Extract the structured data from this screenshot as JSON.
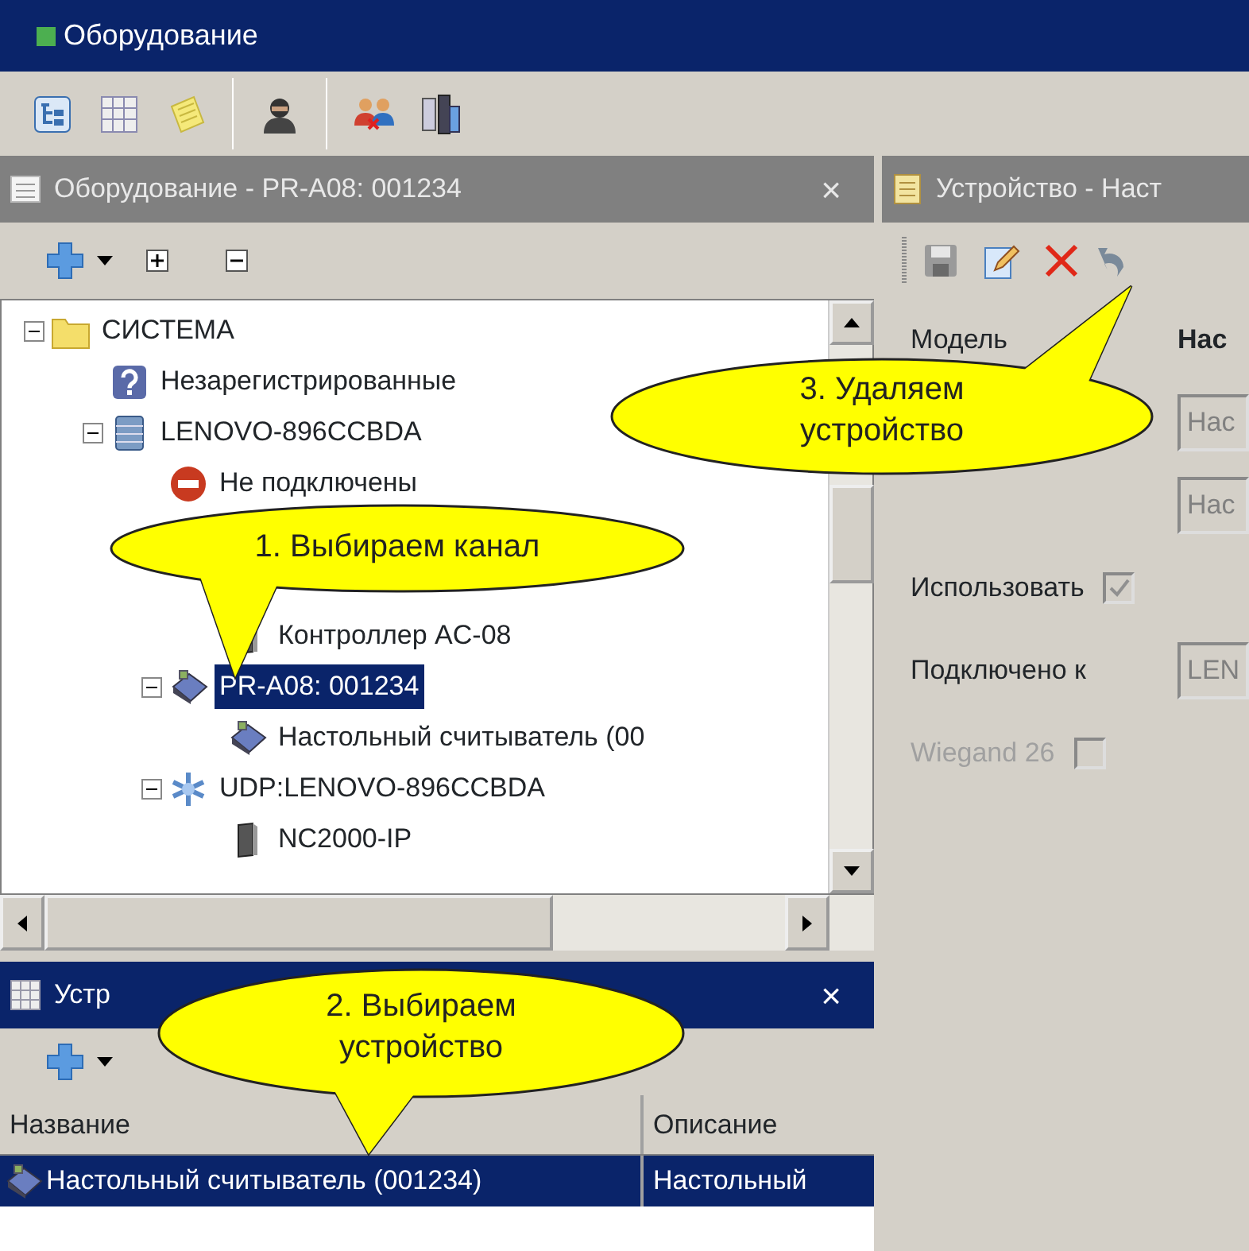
{
  "window": {
    "title": "Оборудование"
  },
  "tree_panel": {
    "title": "Оборудование - PR-A08: 001234",
    "close": "×",
    "tree": [
      {
        "label": "СИСТЕМА",
        "kind": "folder",
        "expanded": true,
        "selected": false,
        "children": [
          {
            "label": "Незарегистрированные",
            "kind": "question",
            "selected": false
          },
          {
            "label": "LENOVO-896CCBDA",
            "kind": "server",
            "expanded": true,
            "selected": false,
            "children": [
              {
                "label": "Не подключены",
                "kind": "stop",
                "selected": false
              },
              {
                "children": [
                  {
                    "label": "Контроллер AC-08",
                    "kind": "controller",
                    "selected": false
                  }
                ]
              },
              {
                "label": "PR-A08: 001234",
                "kind": "reader",
                "expanded": true,
                "selected": true,
                "children": [
                  {
                    "label": "Настольный считыватель (00",
                    "kind": "reader",
                    "selected": false
                  }
                ]
              },
              {
                "label": "UDP:LENOVO-896CCBDA",
                "kind": "network",
                "expanded": true,
                "selected": false,
                "children": [
                  {
                    "label": "NC2000-IP",
                    "kind": "controller",
                    "selected": false
                  }
                ]
              }
            ]
          }
        ]
      }
    ]
  },
  "devices_panel": {
    "title": "Устр",
    "close": "×",
    "columns": [
      "Название",
      "Описание"
    ],
    "rows": [
      {
        "cells": [
          "Настольный считыватель (001234)",
          "Настольный"
        ],
        "selected": true
      }
    ]
  },
  "device_panel": {
    "title": "Устройство - Наст",
    "rows": [
      {
        "kind": "value",
        "label": "Модель",
        "value": "Нас"
      },
      {
        "kind": "field",
        "value": "Нас",
        "disabled": true
      },
      {
        "kind": "field",
        "value": "Нас",
        "disabled": true
      },
      {
        "kind": "checkbox",
        "label": "Использовать",
        "checked": true,
        "disabled": true
      },
      {
        "kind": "field",
        "label": "Подключено к",
        "value": "LEN",
        "disabled": true
      },
      {
        "kind": "checkbox",
        "label": "Wiegand 26",
        "checked": false,
        "disabled": true
      }
    ]
  },
  "callouts": [
    {
      "text": "1. Выбираем канал"
    },
    {
      "text": "2. Выбираем устройство"
    },
    {
      "text": "3. Удаляем устройство"
    }
  ]
}
